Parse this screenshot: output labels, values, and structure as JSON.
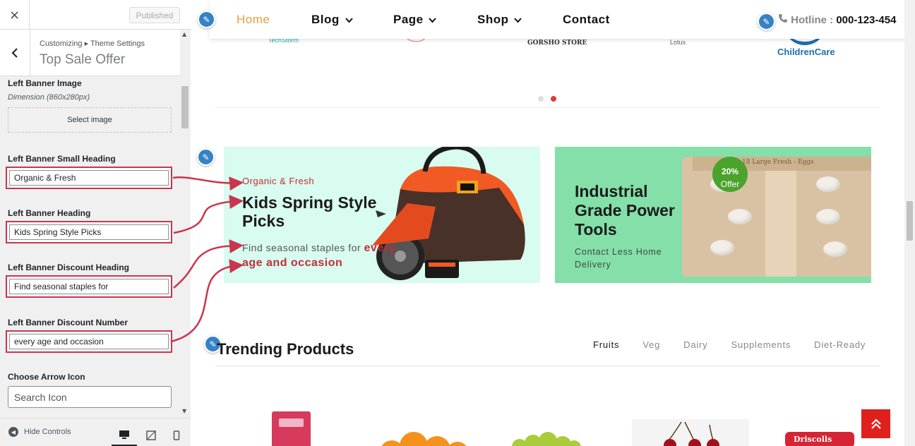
{
  "customizer": {
    "close_icon": "×",
    "published_label": "Published",
    "breadcrumb": "Customizing ▸ Theme Settings",
    "section_title": "Top Sale Offer",
    "fields": {
      "left_banner_image_label": "Left Banner Image",
      "left_banner_image_desc": "Dimension (860x280px)",
      "select_image_label": "Select image",
      "small_heading_label": "Left Banner Small Heading",
      "small_heading_value": "Organic & Fresh",
      "heading_label": "Left Banner Heading",
      "heading_value": "Kids Spring Style Picks",
      "discount_heading_label": "Left Banner Discount Heading",
      "discount_heading_value": "Find seasonal staples for",
      "discount_number_label": "Left Banner Discount Number",
      "discount_number_value": "every age and occasion",
      "arrow_icon_label": "Choose Arrow Icon",
      "search_icon_placeholder": "Search Icon"
    },
    "footer": {
      "hide_controls_label": "Hide Controls"
    }
  },
  "site": {
    "nav": {
      "home": "Home",
      "blog": "Blog",
      "page": "Page",
      "shop": "Shop",
      "contact": "Contact",
      "hotline_label": "Hotline : ",
      "hotline_number": "000-123-454"
    },
    "brand_logos": [
      "TechStorm",
      "GORSHO STORE",
      "Lotus",
      "ChildrenCare"
    ],
    "carousel": {
      "total": 2,
      "active": 2
    },
    "left_banner": {
      "small_heading": "Organic & Fresh",
      "heading": "Kids Spring Style Picks",
      "discount_heading": "Find seasonal staples for ",
      "discount_number": "every age and occasion"
    },
    "right_banner": {
      "heading": "Industrial Grade Power Tools",
      "subtext": "Contact Less Home Delivery",
      "offer_value": "20%",
      "offer_label": "Offer",
      "egg_box_text": "18 Large Fresh - Eggs"
    },
    "trending": {
      "title": "Trending Products",
      "tabs": [
        "Fruits",
        "Veg",
        "Dairy",
        "Supplements",
        "Diet-Ready"
      ],
      "active_tab": "Fruits"
    },
    "product_brand": "Driscolls"
  },
  "colors": {
    "accent_red": "#c42c3b",
    "highlight_border": "#c9364d",
    "nav_active": "#e1a23b",
    "left_banner_bg": "#d8fcef",
    "right_banner_bg": "#84dfa8",
    "offer_badge": "#4aa32b",
    "edit_pencil": "#3582c4"
  }
}
